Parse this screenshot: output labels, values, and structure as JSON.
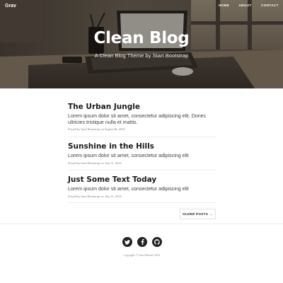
{
  "nav": {
    "brand": "Grav",
    "links": [
      {
        "label": "HOME"
      },
      {
        "label": "ABOUT"
      },
      {
        "label": "CONTACT"
      }
    ]
  },
  "header": {
    "title": "Clean Blog",
    "subtitle": "A Clean Blog Theme by Start Bootstrap"
  },
  "posts": [
    {
      "title": "The Urban Jungle",
      "subtitle": "Lorem ipsum dolor sit amet, consectetur adipiscing elit. Donec ultricies tristique nulla et mattis.",
      "meta": "Posted by Start Bootstrap on August 06, 2014"
    },
    {
      "title": "Sunshine in the Hills",
      "subtitle": "Lorem ipsum dolor sit amet, consectetur adipiscing elit",
      "meta": "Posted by Start Bootstrap on July 31, 2014"
    },
    {
      "title": "Just Some Text Today",
      "subtitle": "Lorem ipsum dolor sit amet, consectetur adipiscing elit",
      "meta": "Posted by Start Bootstrap on July 31, 2014"
    }
  ],
  "pager": {
    "older_label": "OLDER POSTS",
    "arrow": "→"
  },
  "footer": {
    "social": [
      {
        "icon": "twitter-icon"
      },
      {
        "icon": "facebook-icon"
      },
      {
        "icon": "github-icon"
      }
    ],
    "copyright": "Copyright © Your Website 2016"
  },
  "colors": {
    "footer_icon_bg": "#222222",
    "title_text": "#1a1a1a",
    "body_text": "#404040",
    "meta_text": "#808080"
  }
}
